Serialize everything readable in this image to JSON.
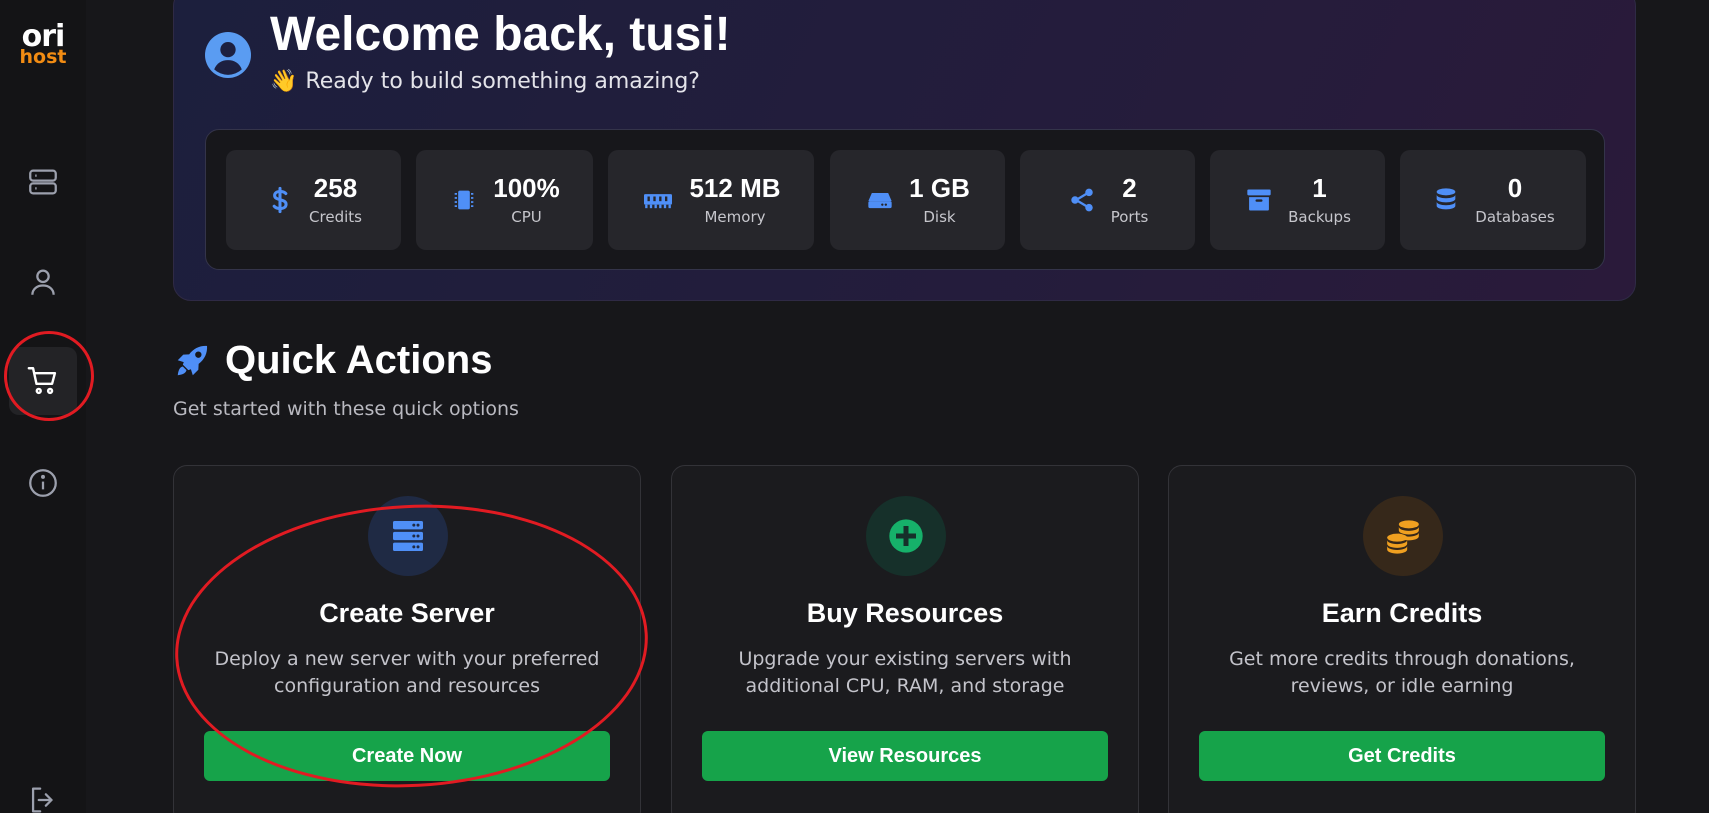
{
  "brand": {
    "line1": "ori",
    "line2": "host"
  },
  "sidebar": {
    "items": [
      {
        "icon": "server-icon"
      },
      {
        "icon": "user-icon"
      },
      {
        "icon": "cart-icon",
        "active": true
      },
      {
        "icon": "info-icon"
      },
      {
        "icon": "logout-icon"
      }
    ]
  },
  "welcome": {
    "title": "Welcome back, tusi!",
    "wave": "👋",
    "subtitle": "Ready to build something amazing?"
  },
  "stats": [
    {
      "value": "258",
      "label": "Credits",
      "icon": "dollar-icon"
    },
    {
      "value": "100%",
      "label": "CPU",
      "icon": "cpu-icon"
    },
    {
      "value": "512 MB",
      "label": "Memory",
      "icon": "memory-icon"
    },
    {
      "value": "1 GB",
      "label": "Disk",
      "icon": "disk-icon"
    },
    {
      "value": "2",
      "label": "Ports",
      "icon": "share-icon"
    },
    {
      "value": "1",
      "label": "Backups",
      "icon": "archive-icon"
    },
    {
      "value": "0",
      "label": "Databases",
      "icon": "database-icon"
    }
  ],
  "quick_actions": {
    "title": "Quick Actions",
    "subtitle": "Get started with these quick options",
    "cards": [
      {
        "title": "Create Server",
        "description": "Deploy a new server with your preferred configuration and resources",
        "button": "Create Now",
        "icon": "server-stack-icon"
      },
      {
        "title": "Buy Resources",
        "description": "Upgrade your existing servers with additional CPU, RAM, and storage",
        "button": "View Resources",
        "icon": "plus-circle-icon"
      },
      {
        "title": "Earn Credits",
        "description": "Get more credits through donations, reviews, or idle earning",
        "button": "Get Credits",
        "icon": "coins-icon"
      }
    ]
  },
  "colors": {
    "accent_blue": "#4f8ff7",
    "button_green": "#16a34a",
    "brand_orange": "#f28c13",
    "annotation_red": "#e11b22"
  }
}
